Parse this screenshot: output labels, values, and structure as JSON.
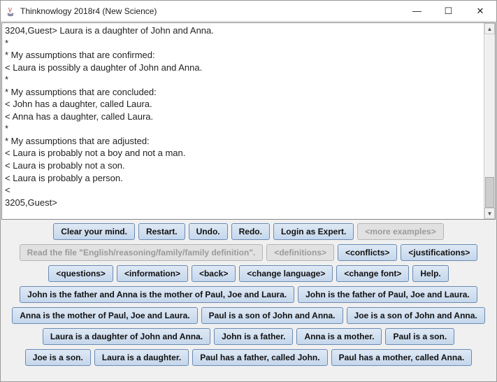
{
  "window": {
    "title": "Thinknowlogy 2018r4 (New Science)",
    "min": "—",
    "max": "☐",
    "close": "✕"
  },
  "console": {
    "lines": [
      "3204,Guest> Laura is a daughter of John and Anna.",
      "*",
      "* My assumptions that are confirmed:",
      "< Laura is possibly a daughter of John and Anna.",
      "*",
      "* My assumptions that are concluded:",
      "< John has a daughter, called Laura.",
      "< Anna has a daughter, called Laura.",
      "*",
      "* My assumptions that are adjusted:",
      "< Laura is probably not a boy and not a man.",
      "< Laura is probably not a son.",
      "< Laura is probably a person.",
      "<",
      "3205,Guest> "
    ]
  },
  "rows": {
    "r1": {
      "clear": "Clear your mind.",
      "restart": "Restart.",
      "undo": "Undo.",
      "redo": "Redo.",
      "login": "Login as Expert.",
      "more": "<more examples>"
    },
    "r2": {
      "readfile": "Read the file \"English/reasoning/family/family definition\".",
      "definitions": "<definitions>",
      "conflicts": "<conflicts>",
      "justifications": "<justifications>"
    },
    "r3": {
      "questions": "<questions>",
      "information": "<information>",
      "back": "<back>",
      "changelang": "<change language>",
      "changefont": "<change font>",
      "help": "Help."
    },
    "r4": {
      "b1": "John is the father and Anna is the mother of Paul, Joe and Laura.",
      "b2": "John is the father of Paul, Joe and Laura."
    },
    "r5": {
      "b1": "Anna is the mother of Paul, Joe and Laura.",
      "b2": "Paul is a son of John and Anna.",
      "b3": "Joe is a son of John and Anna."
    },
    "r6": {
      "b1": "Laura is a daughter of John and Anna.",
      "b2": "John is a father.",
      "b3": "Anna is a mother.",
      "b4": "Paul is a son."
    },
    "r7": {
      "b1": "Joe is a son.",
      "b2": "Laura is a daughter.",
      "b3": "Paul has a father, called John.",
      "b4": "Paul has a mother, called Anna."
    }
  }
}
